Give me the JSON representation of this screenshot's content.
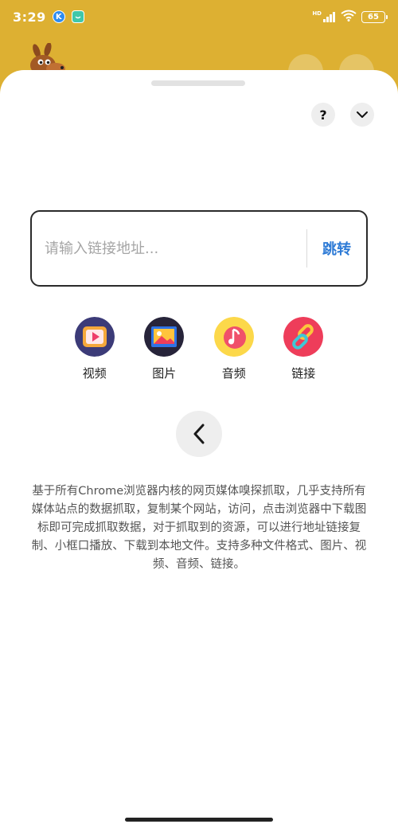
{
  "status_bar": {
    "time": "3:29",
    "app_icons": [
      "k-app-icon",
      "chat-app-icon"
    ],
    "hd_label": "HD",
    "battery": "65"
  },
  "header": {
    "logo": "kangaroo-icon",
    "actions": [
      "share-icon",
      "user-icon"
    ]
  },
  "sheet": {
    "help_label": "?",
    "url_input": {
      "value": "",
      "placeholder": "请输入链接地址..."
    },
    "jump_label": "跳转",
    "categories": [
      {
        "label": "视频",
        "icon": "video-icon"
      },
      {
        "label": "图片",
        "icon": "image-icon"
      },
      {
        "label": "音频",
        "icon": "music-icon"
      },
      {
        "label": "链接",
        "icon": "link-icon"
      }
    ],
    "description": "基于所有Chrome浏览器内核的网页媒体嗅探抓取，几乎支持所有媒体站点的数据抓取，复制某个网站，访问，点击浏览器中下载图标即可完成抓取数据，对于抓取到的资源，可以进行地址链接复制、小框口播放、下载到本地文件。支持多种文件格式、图片、视频、音频、链接。"
  },
  "colors": {
    "header_bg": "#DDB032",
    "accent_blue": "#2E7BD6",
    "sheet_bg": "#FFFFFF"
  }
}
